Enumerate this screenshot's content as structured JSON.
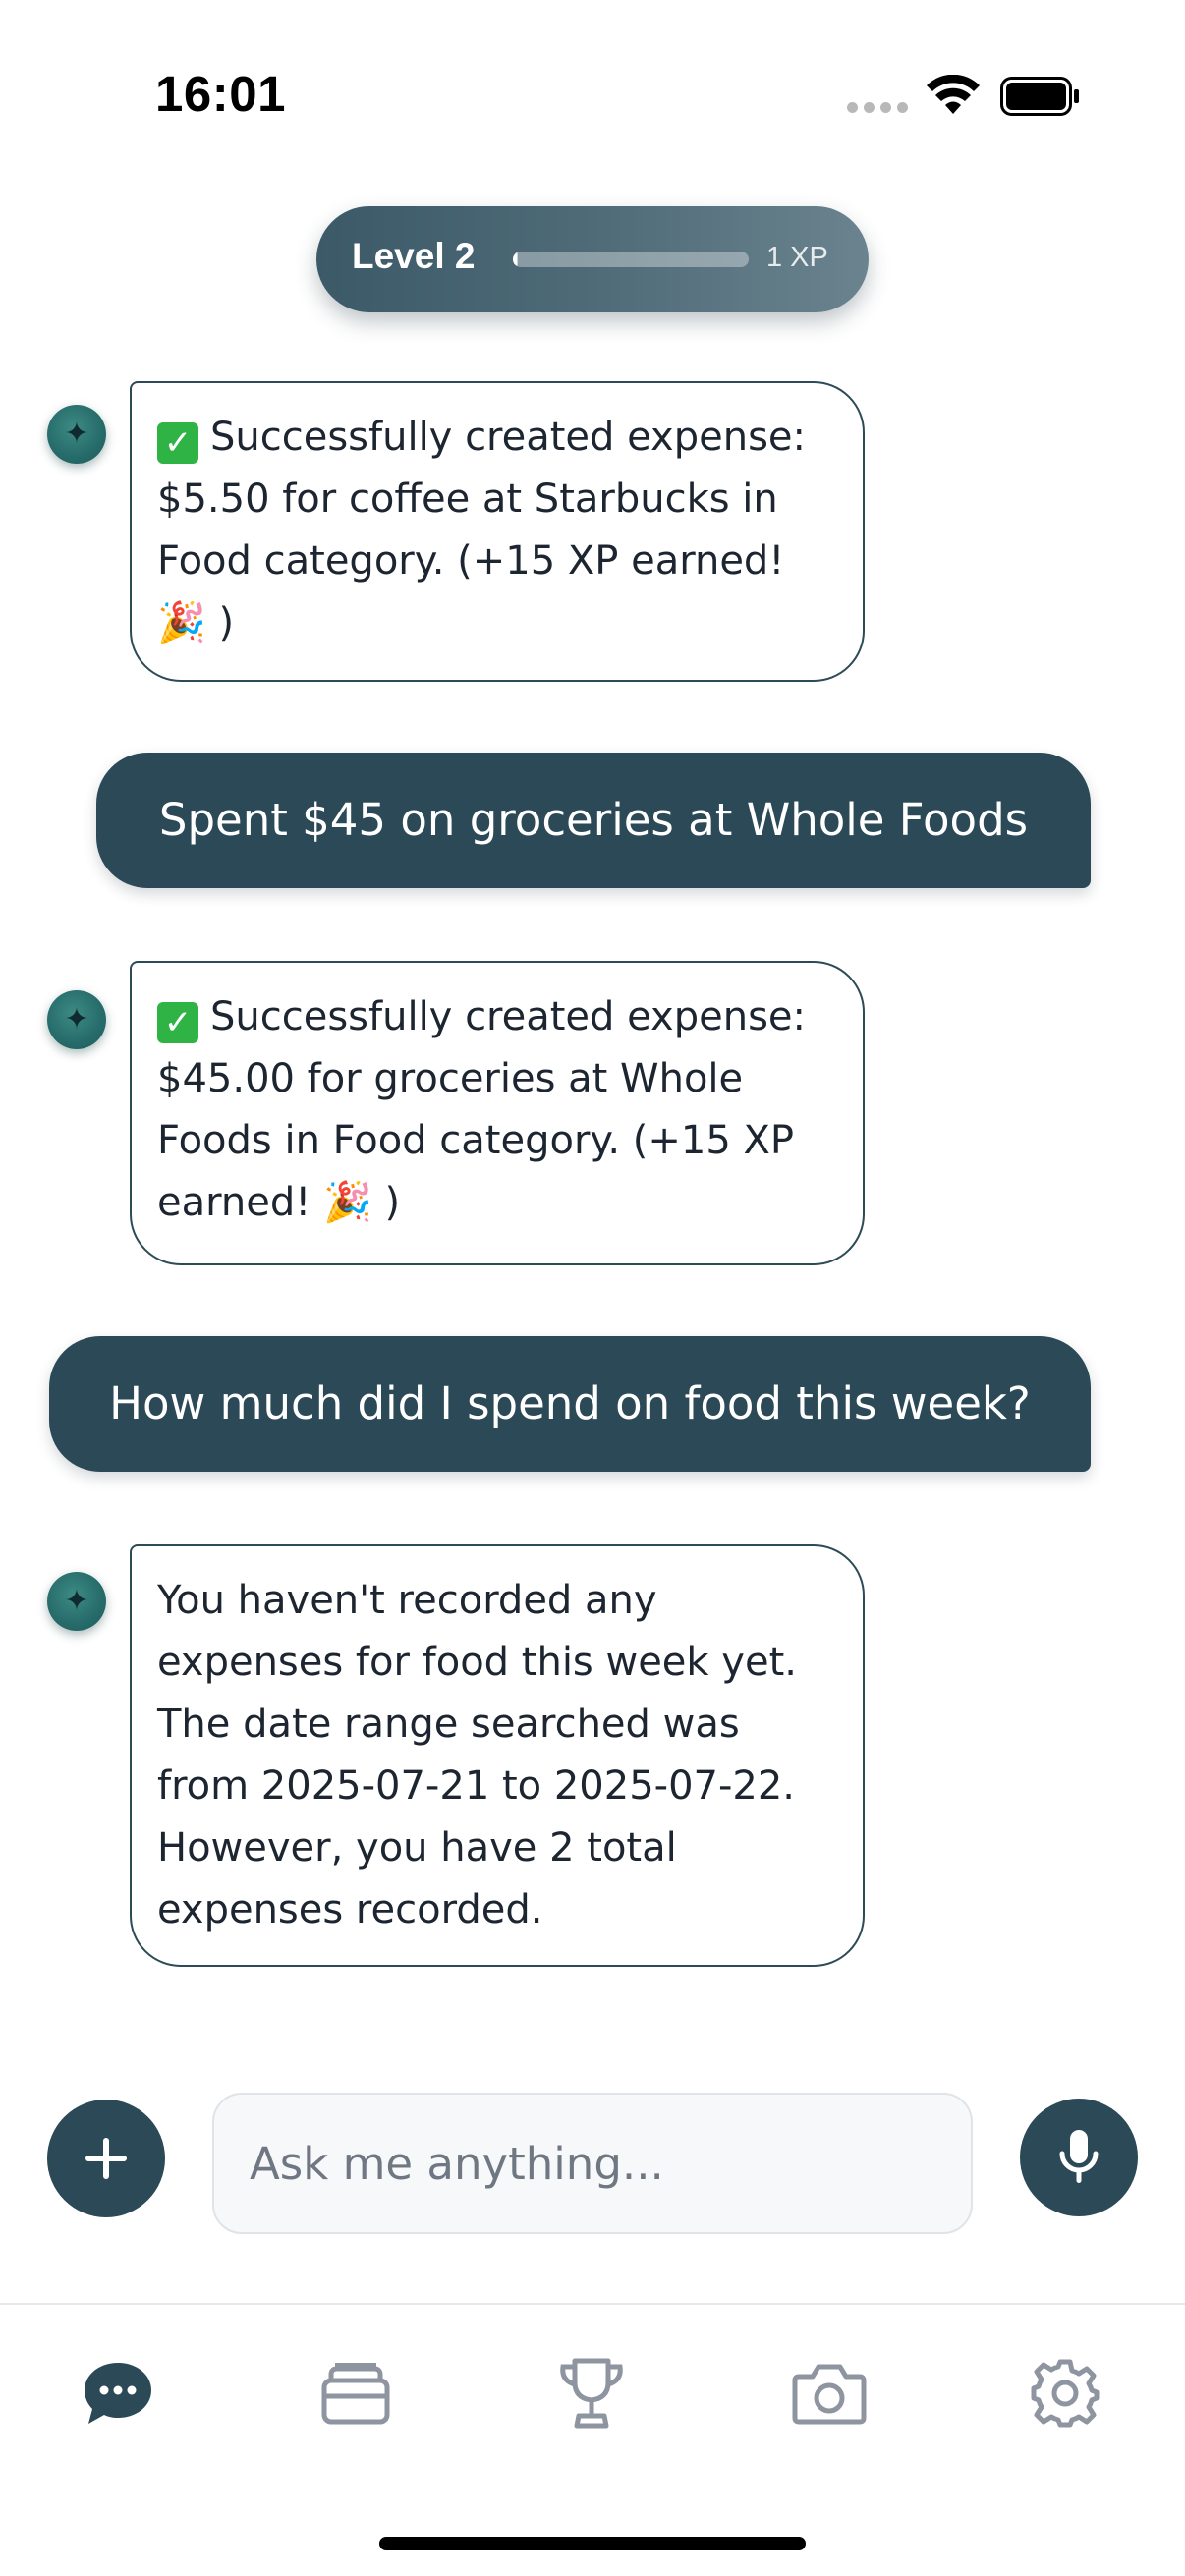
{
  "status_bar": {
    "time": "16:01"
  },
  "level": {
    "label": "Level 2",
    "xp_text": "1 XP",
    "xp_progress": 0.02
  },
  "messages": [
    {
      "role": "assistant",
      "check": "✓",
      "text": "Successfully created expense: $5.50 for coffee at Starbucks in Food category. (+15 XP earned! 🎉 )"
    },
    {
      "role": "user",
      "text": "Spent $45 on groceries at Whole Foods"
    },
    {
      "role": "assistant",
      "check": "✓",
      "text": "Successfully created expense: $45.00 for groceries at Whole Foods in Food category. (+15 XP earned! 🎉 )"
    },
    {
      "role": "user",
      "text": "How much did I spend on food this week?"
    },
    {
      "role": "assistant",
      "text": "You haven't recorded any expenses for food this week yet. The date range searched was from 2025-07-21 to 2025-07-22. However, you have 2 total expenses recorded."
    }
  ],
  "composer": {
    "placeholder": "Ask me anything...",
    "value": ""
  },
  "tabs": [
    {
      "icon": "chat-icon",
      "active": true
    },
    {
      "icon": "wallet-icon",
      "active": false
    },
    {
      "icon": "trophy-icon",
      "active": false
    },
    {
      "icon": "camera-icon",
      "active": false
    },
    {
      "icon": "gear-icon",
      "active": false
    }
  ],
  "colors": {
    "primary": "#2b4956",
    "accent_green": "#2fb345",
    "inactive_icon": "#8e95a0"
  }
}
